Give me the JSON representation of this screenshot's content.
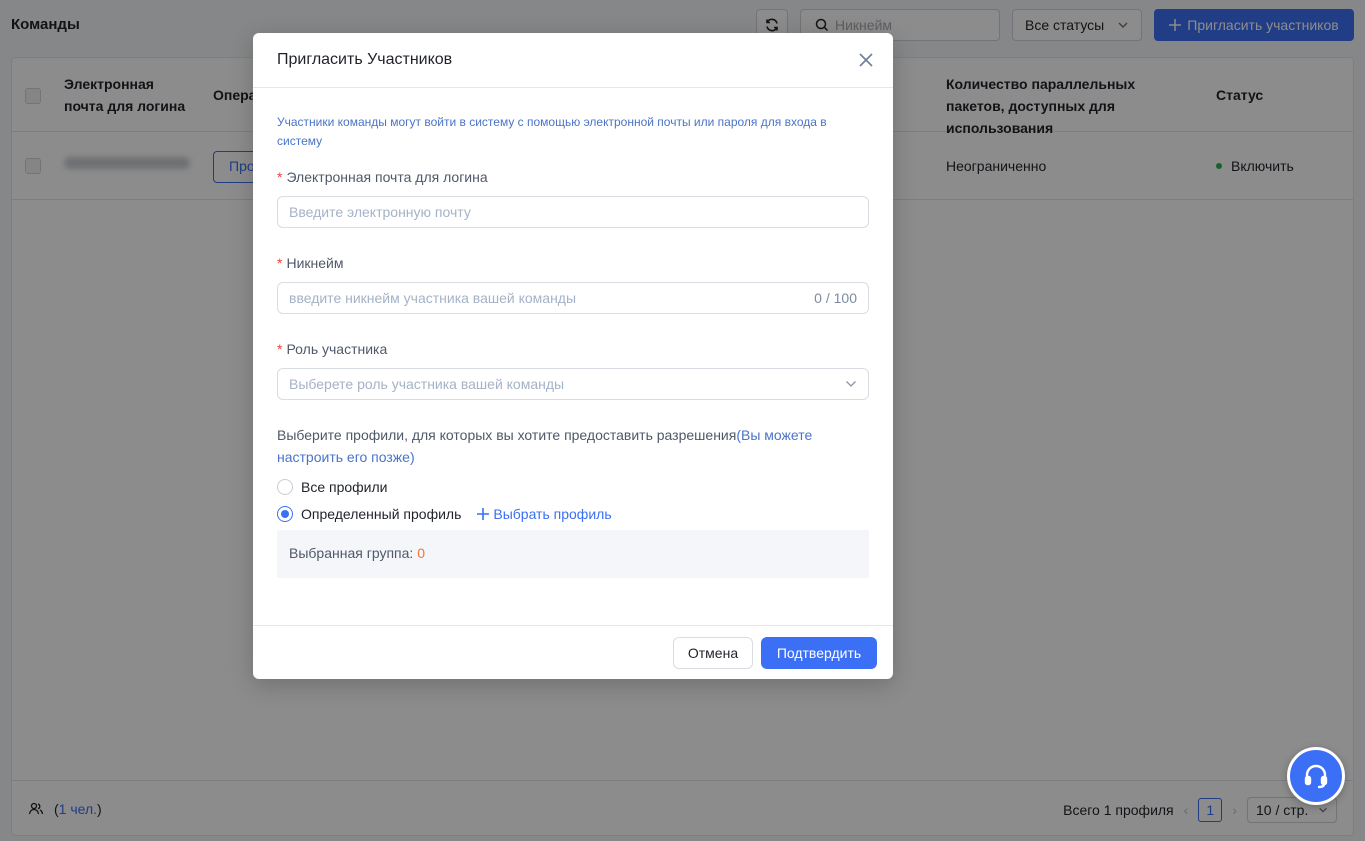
{
  "page": {
    "title": "Команды",
    "search_placeholder": "Никнейм",
    "status_filter": "Все статусы",
    "invite_button": "Пригласить участников"
  },
  "table": {
    "columns": {
      "email": "Электронная почта для логина",
      "operations": "Опера",
      "parallel_packages": "Количество параллельных пакетов, доступных для использования",
      "status": "Статус"
    },
    "rows": [
      {
        "email": "kristhmantulova@...",
        "operation": "Про",
        "parallel_packages": "Неограниченно",
        "status": "Включить"
      }
    ]
  },
  "footer": {
    "members_count": "1 чел.",
    "total": "Всего 1 профиля",
    "page": "1",
    "page_size": "10 / стр."
  },
  "modal": {
    "title": "Пригласить Участников",
    "info": "Участники команды могут войти в систему с помощью электронной почты или пароля для входа в систему",
    "email_label": "Электронная почта для логина",
    "email_placeholder": "Введите электронную почту",
    "nickname_label": "Никнейм",
    "nickname_placeholder": "введите никнейм участника вашей команды",
    "nickname_counter": "0 / 100",
    "role_label": "Роль участника",
    "role_placeholder": "Выберете роль участника вашей команды",
    "permissions_text": "Выберите профили, для которых вы хотите предоставить разрешения",
    "permissions_hint": "(Вы можете настроить его позже)",
    "radio_all": "Все профили",
    "radio_specific": "Определенный профиль",
    "choose_profile": "Выбрать профиль",
    "selected_group_label": "Выбранная группа:",
    "selected_group_count": "0",
    "cancel": "Отмена",
    "confirm": "Подтвердить"
  },
  "colors": {
    "accent": "#3b6ff5",
    "required": "#f53f3f",
    "status_enabled": "#2bb24c",
    "count_highlight": "#f77234"
  }
}
